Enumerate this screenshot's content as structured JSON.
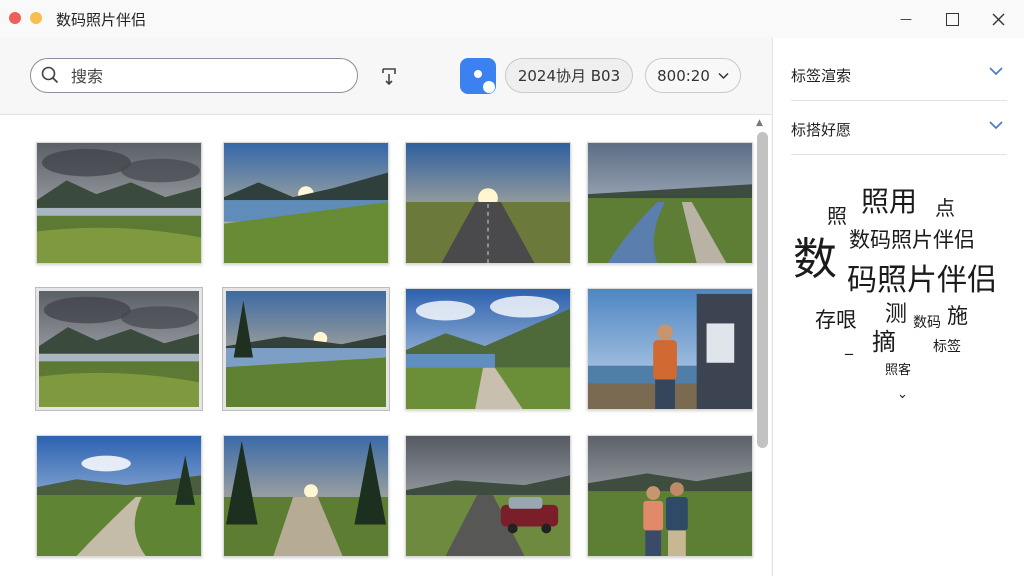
{
  "app": {
    "title": "数码照片伴侣"
  },
  "window_controls": {
    "minimize": "—"
  },
  "toolbar": {
    "search_placeholder": "搜索",
    "date_filter": "2024协月 B03",
    "size_filter": "800:20"
  },
  "gallery": {
    "photos": [
      {
        "scene": "lake-mountain-cloudy"
      },
      {
        "scene": "lake-sunset"
      },
      {
        "scene": "road-sunset"
      },
      {
        "scene": "river-path"
      },
      {
        "scene": "lake-mountain-cloudy"
      },
      {
        "scene": "lake-sunset-trees"
      },
      {
        "scene": "lake-road-valley"
      },
      {
        "scene": "man-by-house"
      },
      {
        "scene": "trail-valley"
      },
      {
        "scene": "forest-trail-sunset"
      },
      {
        "scene": "road-with-car"
      },
      {
        "scene": "couple-portrait"
      }
    ]
  },
  "panel": {
    "accordion_1": "标签渲索",
    "accordion_2": "标搭好愿",
    "tag_cloud": [
      {
        "text": "照",
        "size": 20
      },
      {
        "text": "照用",
        "size": 28
      },
      {
        "text": "点",
        "size": 20
      },
      {
        "text": "数",
        "size": 44
      },
      {
        "text": "数码照片伴侣",
        "size": 21
      },
      {
        "text": "码照片伴侣",
        "size": 30
      },
      {
        "text": "存哏",
        "size": 21
      },
      {
        "text": "测",
        "size": 22
      },
      {
        "text": "施",
        "size": 21
      },
      {
        "text": "数码",
        "size": 14
      },
      {
        "text": "摘",
        "size": 24
      },
      {
        "text": "_",
        "size": 16
      },
      {
        "text": "标签",
        "size": 14
      },
      {
        "text": "照客",
        "size": 13
      },
      {
        "text": "⌄",
        "size": 13
      }
    ]
  },
  "colors": {
    "accent": "#3b82f0",
    "chevron": "#4a7fd0"
  }
}
